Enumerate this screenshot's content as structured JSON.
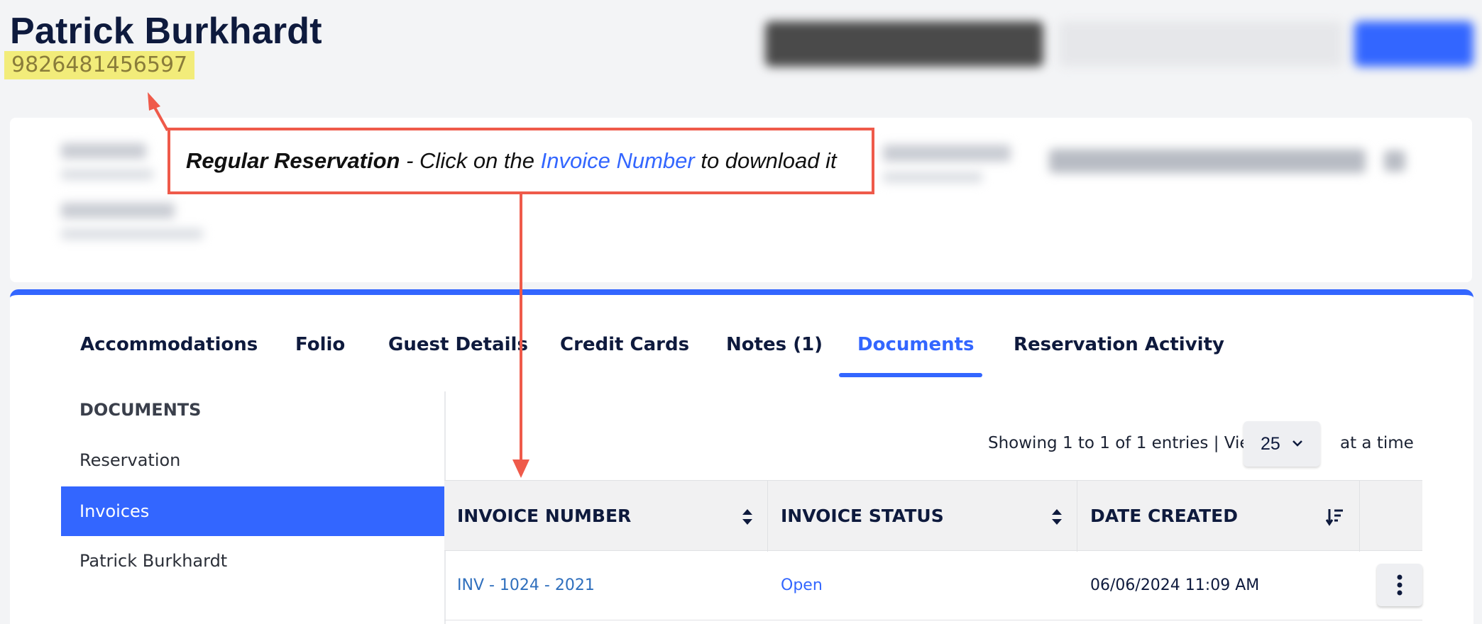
{
  "header": {
    "guest_name": "Patrick Burkhardt",
    "confirmation_number": "9826481456597",
    "highlight_color": "#f2ec7a"
  },
  "tabs": [
    {
      "label": "Accommodations"
    },
    {
      "label": "Folio"
    },
    {
      "label": "Guest Details"
    },
    {
      "label": "Credit Cards"
    },
    {
      "label": "Notes (1)"
    },
    {
      "label": "Documents",
      "active": true
    },
    {
      "label": "Reservation Activity"
    }
  ],
  "documents_sidebar": {
    "heading": "DOCUMENTS",
    "items": [
      {
        "label": "Reservation"
      },
      {
        "label": "Invoices",
        "active": true
      },
      {
        "label": "Patrick Burkhardt"
      }
    ]
  },
  "pagination": {
    "entries_text": "Showing 1 to 1 of 1 entries | View",
    "page_size": "25",
    "suffix": "at a time"
  },
  "table": {
    "columns": [
      "INVOICE NUMBER",
      "INVOICE STATUS",
      "DATE CREATED"
    ],
    "rows": [
      {
        "invoice_number": "INV - 1024 - 2021",
        "status": "Open",
        "date_created": "06/06/2024 11:09 AM"
      }
    ]
  },
  "callout": {
    "bold": "Regular Reservation",
    "text_before": " - Click on the ",
    "highlight": "Invoice Number",
    "text_after": " to download it"
  },
  "colors": {
    "accent": "#3366ff",
    "annotation": "#ef5a4a",
    "link": "#2f6fbd"
  }
}
